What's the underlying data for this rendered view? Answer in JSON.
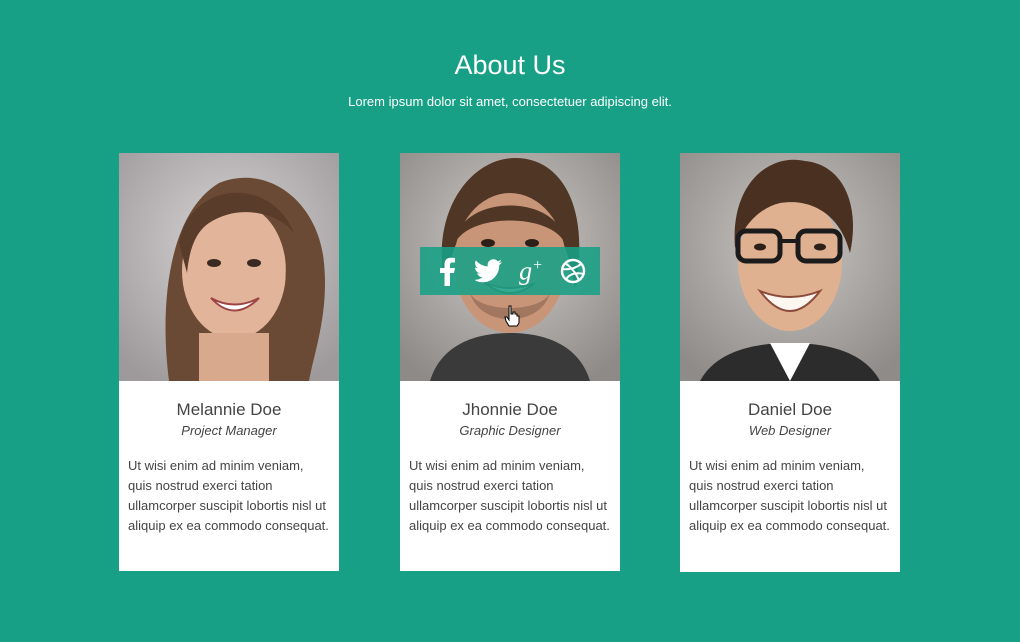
{
  "header": {
    "title": "About Us",
    "subtitle": "Lorem ipsum dolor sit amet, consectetuer adipiscing elit."
  },
  "team": [
    {
      "name": "Melannie Doe",
      "role": "Project Manager",
      "bio": "Ut wisi enim ad minim veniam, quis nostrud exerci tation ullamcorper suscipit lobortis nisl ut aliquip ex ea commodo consequat."
    },
    {
      "name": "Jhonnie Doe",
      "role": "Graphic Designer",
      "bio": "Ut wisi enim ad minim veniam, quis nostrud exerci tation ullamcorper suscipit lobortis nisl ut aliquip ex ea commodo consequat."
    },
    {
      "name": "Daniel Doe",
      "role": "Web Designer",
      "bio": "Ut wisi enim ad minim veniam, quis nostrud exerci tation ullamcorper suscipit lobortis nisl ut aliquip ex ea commodo consequat."
    }
  ],
  "social_icons": [
    "facebook-icon",
    "twitter-icon",
    "google-plus-icon",
    "dribbble-icon"
  ],
  "colors": {
    "background": "#17a085",
    "card": "#ffffff",
    "text": "#444444"
  }
}
